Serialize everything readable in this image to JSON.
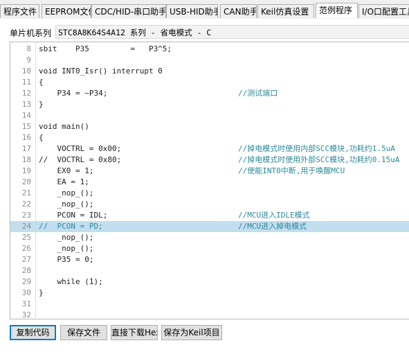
{
  "tabs": [
    {
      "label": "程序文件",
      "active": false
    },
    {
      "label": "EEPROM文件",
      "active": false
    },
    {
      "label": "CDC/HID-串口助手",
      "active": false
    },
    {
      "label": "USB-HID助手",
      "active": false
    },
    {
      "label": "CAN助手",
      "active": false
    },
    {
      "label": "Keil仿真设置",
      "active": false
    },
    {
      "label": "范例程序",
      "active": true
    },
    {
      "label": "I/O口配置工具",
      "active": false
    }
  ],
  "series": {
    "label": "单片机系列",
    "value": "STC8A8K64S4A12 系列 - 省电模式 - C"
  },
  "highlight_color": "#c2deef",
  "comment_color": "#2d8a9a",
  "code": [
    {
      "num": "8",
      "text": "sbit    P35         =   P3^5;",
      "comment": ""
    },
    {
      "num": "9",
      "text": "",
      "comment": ""
    },
    {
      "num": "10",
      "text": "void INT0_Isr() interrupt 0",
      "comment": ""
    },
    {
      "num": "11",
      "text": "{",
      "comment": ""
    },
    {
      "num": "12",
      "text": "    P34 = ~P34;",
      "comment": "//测试端口"
    },
    {
      "num": "13",
      "text": "}",
      "comment": ""
    },
    {
      "num": "14",
      "text": "",
      "comment": ""
    },
    {
      "num": "15",
      "text": "void main()",
      "comment": ""
    },
    {
      "num": "16",
      "text": "{",
      "comment": ""
    },
    {
      "num": "17",
      "text": "    VOCTRL = 0x00;",
      "comment": "//掉电模式时使用内部SCC模块,功耗约1.5uA"
    },
    {
      "num": "18",
      "text": "//  VOCTRL = 0x80;",
      "comment": "//掉电模式时使用外部SCC模块,功耗约0.15uA"
    },
    {
      "num": "19",
      "text": "    EX0 = 1;",
      "comment": "//使能INT0中断,用于唤醒MCU"
    },
    {
      "num": "20",
      "text": "    EA = 1;",
      "comment": ""
    },
    {
      "num": "21",
      "text": "    _nop_();",
      "comment": ""
    },
    {
      "num": "22",
      "text": "    _nop_();",
      "comment": ""
    },
    {
      "num": "23",
      "text": "    PCON = IDL;",
      "comment": "//MCU进入IDLE模式"
    },
    {
      "num": "24",
      "text": "//  PCON = PD;",
      "comment": "//MCU进入掉电模式",
      "highlight": true
    },
    {
      "num": "25",
      "text": "    _nop_();",
      "comment": ""
    },
    {
      "num": "26",
      "text": "    _nop_();",
      "comment": ""
    },
    {
      "num": "27",
      "text": "    P35 = 0;",
      "comment": ""
    },
    {
      "num": "28",
      "text": "",
      "comment": ""
    },
    {
      "num": "29",
      "text": "    while (1);",
      "comment": ""
    },
    {
      "num": "30",
      "text": "}",
      "comment": ""
    },
    {
      "num": "31",
      "text": "",
      "comment": ""
    },
    {
      "num": "32",
      "text": "",
      "comment": ""
    }
  ],
  "buttons": {
    "copy": "复制代码",
    "save_file": "保存文件",
    "download_hex": "直接下载Hex",
    "save_keil": "保存为Keil项目"
  }
}
